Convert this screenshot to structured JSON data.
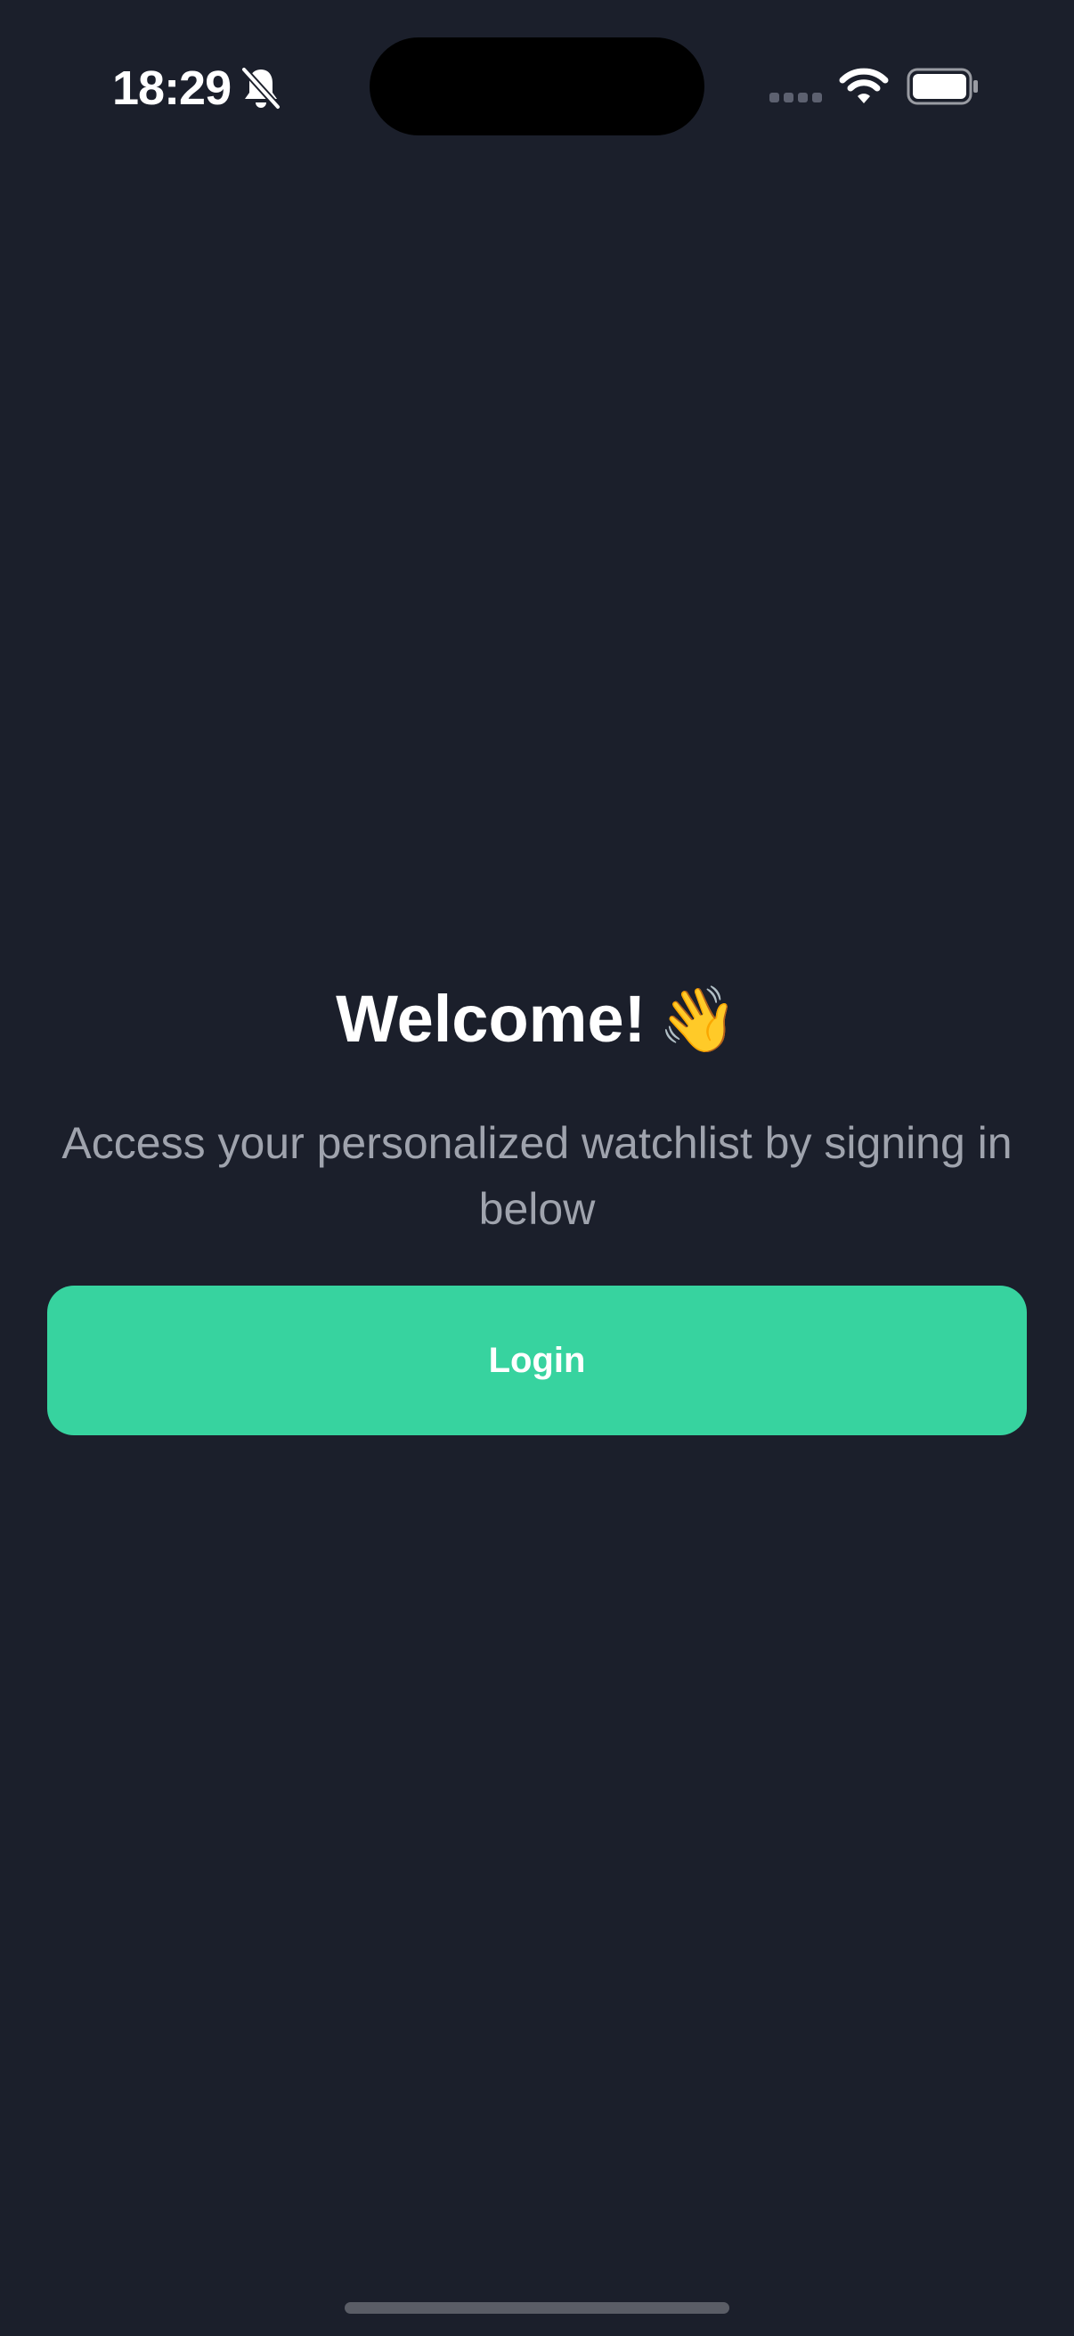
{
  "status_bar": {
    "time": "18:29"
  },
  "icons": {
    "silent_mode": "bell-off-icon",
    "cellular": "signal-icon",
    "wifi": "wifi-icon",
    "battery": "battery-icon"
  },
  "welcome": {
    "title": "Welcome!",
    "emoji": "👋",
    "subtitle": "Access your personalized watchlist by signing in below"
  },
  "login": {
    "label": "Login"
  },
  "colors": {
    "background": "#1b1f2b",
    "accent": "#37d39f",
    "subtitle": "#9fa3ad"
  }
}
